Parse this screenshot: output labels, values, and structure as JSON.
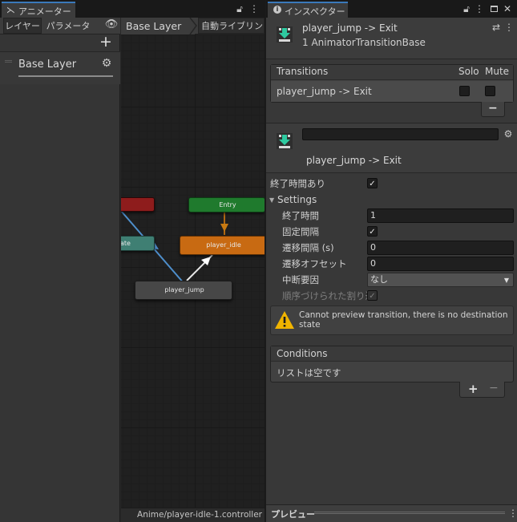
{
  "animator": {
    "tab_title": "アニメーター",
    "toolbar": {
      "layers_label": "レイヤー",
      "parameters_label": "パラメーター",
      "add_label": "+"
    },
    "layers": [
      {
        "name": "Base Layer"
      }
    ],
    "breadcrumb": "Base Layer",
    "auto_live_link": "自動ライブリンク",
    "status_path": "Anime/player-idle-1.controller",
    "nodes": {
      "entry": "Entry",
      "idle": "player_idle",
      "jump": "player_jump",
      "partial": "ate"
    }
  },
  "inspector": {
    "tab_title": "インスペクター",
    "header": {
      "title": "player_jump -> Exit",
      "subtitle": "1 AnimatorTransitionBase"
    },
    "transitions": {
      "header": "Transitions",
      "solo_label": "Solo",
      "mute_label": "Mute",
      "items": [
        {
          "label": "player_jump -> Exit"
        }
      ],
      "remove_label": "−"
    },
    "transition_name": "player_jump -> Exit",
    "has_exit_time_label": "終了時間あり",
    "settings": {
      "label": "Settings",
      "exit_time_label": "終了時間",
      "exit_time_value": "1",
      "fixed_duration_label": "固定間隔",
      "duration_label": "遷移間隔 (s)",
      "duration_value": "0",
      "offset_label": "遷移オフセット",
      "offset_value": "0",
      "interruption_label": "中断要因",
      "interruption_value": "なし",
      "ordered_interruption_label": "順序づけられた割り込"
    },
    "warning": "Cannot preview transition, there is no destination state",
    "conditions": {
      "header": "Conditions",
      "empty_text": "リストは空です",
      "add_label": "+",
      "remove_label": "−"
    },
    "preview_label": "プレビュー"
  },
  "colors": {
    "accent": "#3a79bb",
    "entry_node": "#1f7a2d",
    "idle_node": "#c86a12",
    "red_node": "#8e1c1c",
    "teal_node": "#3f7f73",
    "jump_node": "#474747",
    "warning": "#f0b400"
  }
}
